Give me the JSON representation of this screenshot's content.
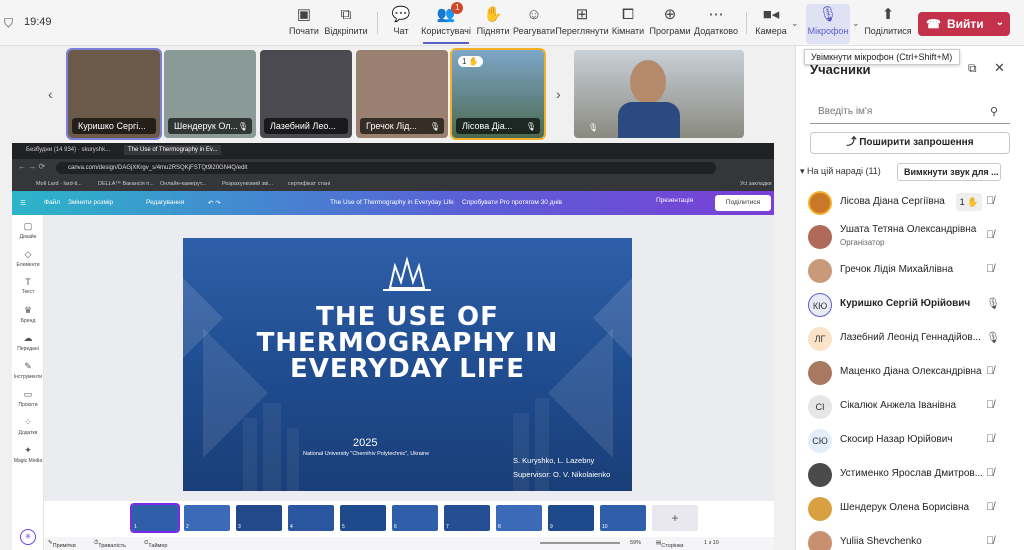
{
  "topbar": {
    "time": "19:49",
    "buttons": [
      {
        "label": "Почати",
        "icon": "record-icon"
      },
      {
        "label": "Відкріпити",
        "icon": "unpin-icon"
      },
      {
        "label": "Чат",
        "icon": "chat-icon"
      },
      {
        "label": "Користувачі",
        "icon": "people-icon",
        "badge": "1"
      },
      {
        "label": "Підняти",
        "icon": "raise-hand-icon"
      },
      {
        "label": "Реагувати",
        "icon": "react-icon"
      },
      {
        "label": "Переглянути",
        "icon": "view-icon"
      },
      {
        "label": "Кімнати",
        "icon": "rooms-icon"
      },
      {
        "label": "Програми",
        "icon": "apps-icon"
      },
      {
        "label": "Додатково",
        "icon": "more-icon"
      },
      {
        "label": "Камера",
        "icon": "camera-icon"
      },
      {
        "label": "Мікрофон",
        "icon": "mic-off-icon"
      },
      {
        "label": "Поділитися",
        "icon": "share-icon"
      }
    ],
    "leave_label": "Вийти",
    "tooltip": "Увімкнути мікрофон (Ctrl+Shift+M)"
  },
  "tiles": [
    {
      "name": "Куришко Сергі...",
      "color": "#6b5a4a"
    },
    {
      "name": "Шендерук Ол...",
      "color": "#8a9a96"
    },
    {
      "name": "Лазебний Лео...",
      "color": "#4a4a50"
    },
    {
      "name": "Гречок Лід...",
      "color": "#9a8070"
    },
    {
      "name": "Лісова Діа...",
      "color": "#5a7a9a",
      "hand": "1"
    },
    {
      "name": "",
      "color": "#7a8a90"
    }
  ],
  "browser": {
    "tabs": [
      "Безбудни (14 934) · skuryshk...",
      "The Use of Thermography in Ev..."
    ],
    "url": "canva.com/design/DAGjXKrgv_s/4mu2RSQKjFSTQt9l20GN4Q/edit",
    "bookmarks": [
      "Moll Lard · lard-ti...",
      "DELLA™ Вакансія п...",
      "Онлайн-камерут...",
      "Розрахунковий зві...",
      "сертифікат стані",
      "Усі закладки"
    ]
  },
  "canva": {
    "file": "Файл",
    "resize": "Змінити розмір",
    "editing": "Редагування",
    "doc_title": "The Use of Thermography in Everyday Life",
    "pro": "Спробувати Pro протягом 30 днів",
    "present": "Презентація",
    "share": "Поділитися",
    "side": [
      "Дизайн",
      "Елементи",
      "Текст",
      "Бренд",
      "Передані",
      "Інструменти",
      "Проєкти",
      "Додатки",
      "Magic Media"
    ],
    "footer": {
      "notes": "Примітки",
      "duration": "Тривалість",
      "timer": "Таймер",
      "zoom": "59%",
      "pages": "Сторінки",
      "page_count": "1 з 10"
    },
    "thumbs": [
      "1",
      "2",
      "3",
      "4",
      "5",
      "6",
      "7",
      "8",
      "9",
      "10"
    ]
  },
  "slide": {
    "line1": "THE USE OF",
    "line2": "THERMOGRAPHY IN",
    "line3": "EVERYDAY LIFE",
    "year": "2025",
    "university": "National University \"Chernihiv Polytechnic\", Ukraine",
    "authors": "S. Kuryshko, L. Lazebny",
    "supervisor": "Supervisor: O. V. Nikolaienko"
  },
  "panel": {
    "title": "Учасники",
    "search_placeholder": "Введіть ім'я",
    "invite": "Поширити запрошення",
    "group": "На цій нараді (11)",
    "mute_all": "Вимкнути звук для ...",
    "participants": [
      {
        "name": "Лісова Діана Сергіївна",
        "initials": "",
        "hand": "1",
        "mic": "off",
        "bold": false
      },
      {
        "name": "Ушата Тетяна Олександрівна",
        "role": "Організатор",
        "initials": "",
        "mic": "off",
        "bold": false
      },
      {
        "name": "Гречок Лідія Михайлівна",
        "initials": "",
        "mic": "off",
        "bold": false
      },
      {
        "name": "Куришко Сергій Юрійович",
        "initials": "КЮ",
        "mic": "on",
        "bold": true
      },
      {
        "name": "Лазебний Леонід Геннадійов...",
        "initials": "ЛГ",
        "mic": "on",
        "bold": false
      },
      {
        "name": "Маценко Діана Олександрівна",
        "initials": "",
        "mic": "off",
        "bold": false
      },
      {
        "name": "Сікалюк Анжела Іванівна",
        "initials": "СІ",
        "mic": "off",
        "bold": false
      },
      {
        "name": "Скосир Назар Юрійович",
        "initials": "СЮ",
        "mic": "off",
        "bold": false
      },
      {
        "name": "Устименко Ярослав Дмитров...",
        "initials": "",
        "mic": "off",
        "bold": false
      },
      {
        "name": "Шендерук Олена Борисівна",
        "initials": "",
        "mic": "off",
        "bold": false
      },
      {
        "name": "Yuliia Shevchenko",
        "initials": "",
        "mic": "off",
        "bold": false
      }
    ]
  }
}
